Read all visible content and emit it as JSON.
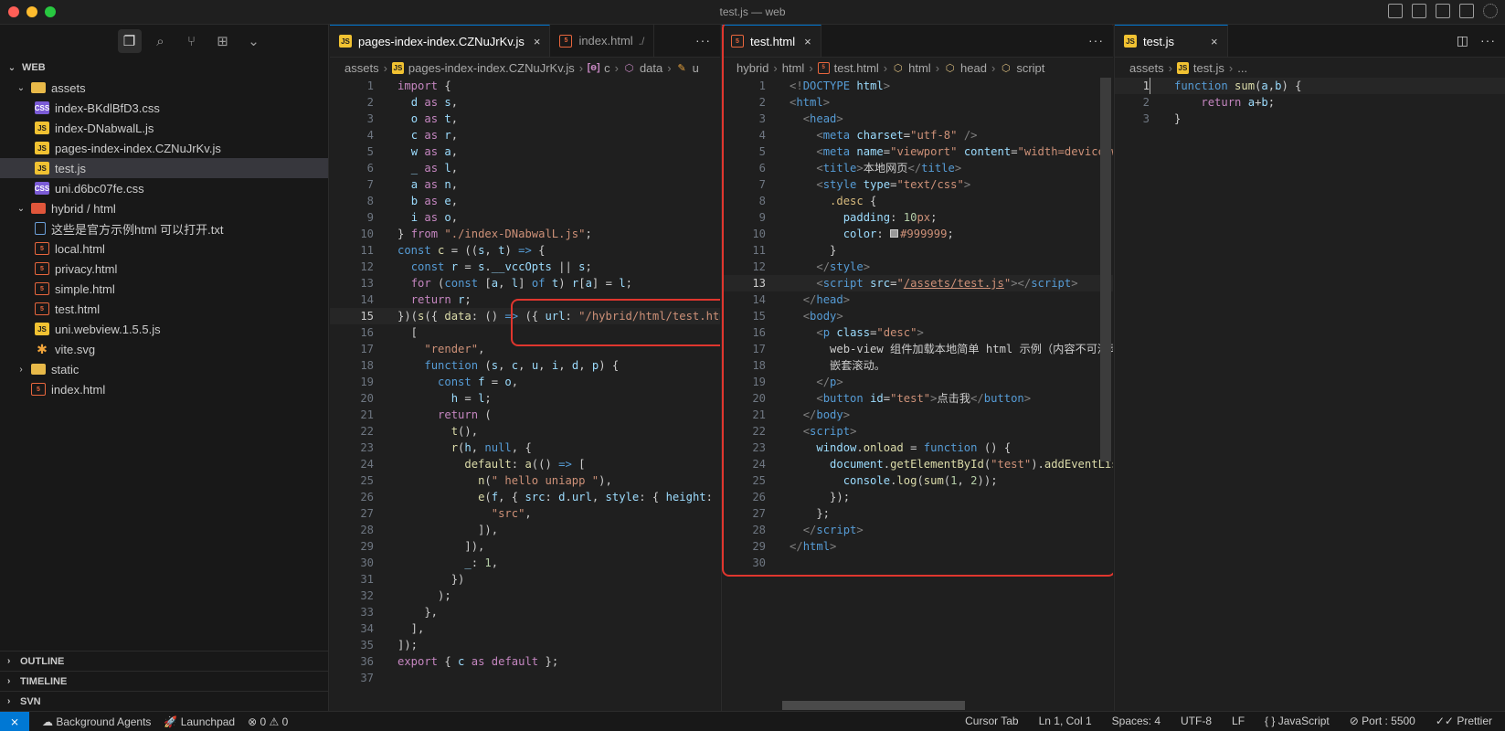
{
  "window": {
    "title": "test.js — web"
  },
  "sidebar": {
    "root": "WEB",
    "tree": [
      {
        "label": "assets",
        "type": "folder",
        "depth": 1,
        "chev": "⌄"
      },
      {
        "label": "index-BKdlBfD3.css",
        "type": "css",
        "depth": 2
      },
      {
        "label": "index-DNabwalL.js",
        "type": "js",
        "depth": 2
      },
      {
        "label": "pages-index-index.CZNuJrKv.js",
        "type": "js",
        "depth": 2
      },
      {
        "label": "test.js",
        "type": "js",
        "depth": 2,
        "selected": true
      },
      {
        "label": "uni.d6bc07fe.css",
        "type": "css",
        "depth": 2
      },
      {
        "label": "hybrid / html",
        "type": "folder-red",
        "depth": 1,
        "chev": "⌄"
      },
      {
        "label": "这些是官方示例html 可以打开.txt",
        "type": "txt",
        "depth": 2
      },
      {
        "label": "local.html",
        "type": "html",
        "depth": 2
      },
      {
        "label": "privacy.html",
        "type": "html",
        "depth": 2
      },
      {
        "label": "simple.html",
        "type": "html",
        "depth": 2
      },
      {
        "label": "test.html",
        "type": "html",
        "depth": 2
      },
      {
        "label": "uni.webview.1.5.5.js",
        "type": "js",
        "depth": 2
      },
      {
        "label": "vite.svg",
        "type": "svg",
        "depth": 2
      },
      {
        "label": "static",
        "type": "folder",
        "depth": 1,
        "chev": "›"
      },
      {
        "label": "index.html",
        "type": "html",
        "depth": 1
      }
    ],
    "sections": [
      "OUTLINE",
      "TIMELINE",
      "SVN"
    ]
  },
  "group1": {
    "tabs": [
      {
        "label": "pages-index-index.CZNuJrKv.js",
        "icon": "js",
        "active": true,
        "close": "×"
      },
      {
        "label": "index.html",
        "icon": "html",
        "active": false,
        "desc": "./"
      }
    ],
    "more": "···",
    "breadcrumb": [
      "assets",
      "pages-index-index.CZNuJrKv.js",
      "c",
      "data",
      "u"
    ]
  },
  "group2": {
    "tabs": [
      {
        "label": "test.html",
        "icon": "html",
        "active": true,
        "close": "×"
      }
    ],
    "more": "···",
    "breadcrumb": [
      "hybrid",
      "html",
      "test.html",
      "html",
      "head",
      "script"
    ]
  },
  "group3": {
    "tabs": [
      {
        "label": "test.js",
        "icon": "js",
        "active": true,
        "close": "×"
      }
    ],
    "more": "···",
    "breadcrumb": [
      "assets",
      "test.js",
      "..."
    ]
  },
  "statusbar": {
    "left": [
      "Background Agents",
      "Launchpad",
      "⊗ 0 ⚠ 0"
    ],
    "right": [
      "Cursor Tab",
      "Ln 1, Col 1",
      "Spaces: 4",
      "UTF-8",
      "LF",
      "{ } JavaScript",
      "Port : 5500",
      "Prettier"
    ]
  }
}
